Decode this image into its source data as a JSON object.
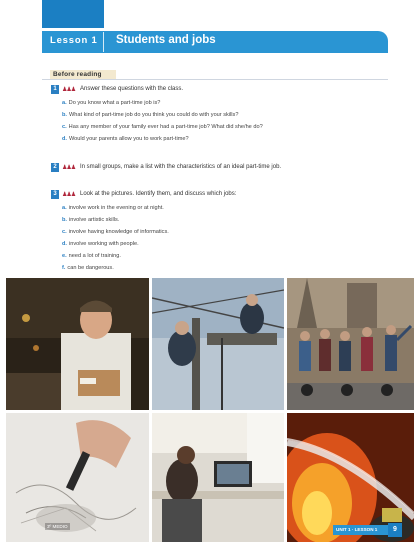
{
  "lesson": {
    "label": "Lesson 1",
    "title": "Students and jobs"
  },
  "section": {
    "label": "Before reading"
  },
  "people_glyph": "♟♟♟",
  "questions": [
    {
      "number": "1",
      "text": "Answer these questions with the class.",
      "items": [
        {
          "letter": "a.",
          "text": "Do you know what a part-time job is?"
        },
        {
          "letter": "b.",
          "text": "What kind of part-time job do you think you could do with your skills?"
        },
        {
          "letter": "c.",
          "text": "Has any member of your family ever had a part-time job? What did she/he do?"
        },
        {
          "letter": "d.",
          "text": "Would your parents allow you to work part-time?"
        }
      ]
    },
    {
      "number": "2",
      "text": "In small groups, make a list with the characteristics of an ideal part-time job.",
      "items": []
    },
    {
      "number": "3",
      "text": "Look at the pictures. Identify them, and discuss which jobs:",
      "items": [
        {
          "letter": "a.",
          "text": "involve work in the evening or at night."
        },
        {
          "letter": "b.",
          "text": "involve artistic skills."
        },
        {
          "letter": "c.",
          "text": "involve having knowledge of informatics."
        },
        {
          "letter": "d.",
          "text": "involve working with people."
        },
        {
          "letter": "e.",
          "text": "need a lot of training."
        },
        {
          "letter": "f.",
          "text": "can be dangerous."
        }
      ]
    }
  ],
  "photos": [
    {
      "name": "delivery-man-photo"
    },
    {
      "name": "electricians-photo"
    },
    {
      "name": "segway-tour-photo"
    },
    {
      "name": "sketching-artist-photo"
    },
    {
      "name": "computer-worker-photo"
    },
    {
      "name": "firefighter-photo"
    }
  ],
  "footer": {
    "unit_label": "UNIT 1 · LESSON 1",
    "page_number": "9",
    "grade": "3º MEDIO"
  },
  "colors": {
    "accent": "#2a95d3",
    "accent_dark": "#1b7fc3",
    "people_icon": "#b0263b",
    "section_bg": "#f3e9cf"
  }
}
